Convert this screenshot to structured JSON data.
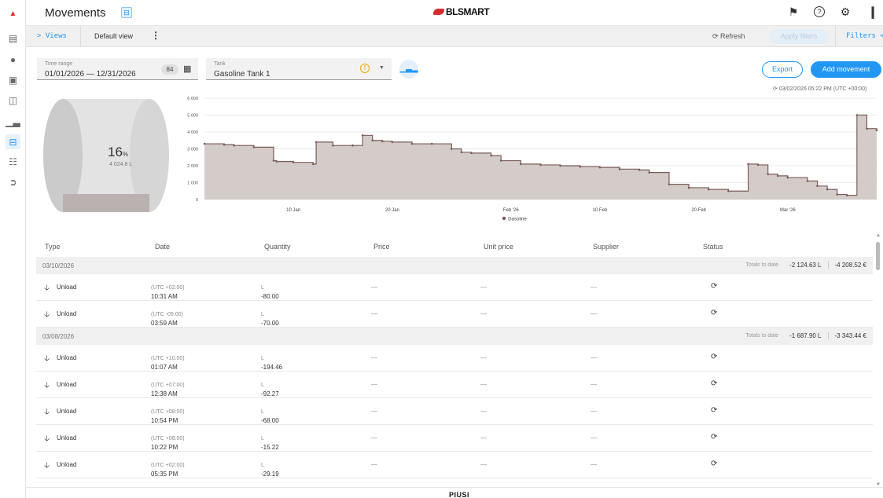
{
  "header": {
    "title": "Movements",
    "brand": "BLSMART",
    "icons": [
      "bell-icon",
      "help-icon",
      "settings-icon",
      "account-icon"
    ]
  },
  "sidebar": {
    "items": [
      "logo-icon",
      "monitor-icon",
      "user-icon",
      "vehicle-icon",
      "fuel-station-icon",
      "bar-chart-icon",
      "movements-icon",
      "map-icon",
      "export-icon"
    ]
  },
  "toolbar": {
    "views_label": "> Views",
    "default_view_label": "Default view",
    "refresh_label": "Refresh",
    "apply_filters_label": "Apply filters",
    "filters_label": "Filters <"
  },
  "filters": {
    "time_range_label": "Time range",
    "time_range_value": "01/01/2026 — 12/31/2026",
    "days_badge": "84",
    "tank_label": "Tank",
    "tank_value": "Gasoline Tank 1"
  },
  "actions": {
    "export_label": "Export",
    "add_label": "Add movement",
    "sync_timestamp": "03/02/2026 05:22 PM (UTC +00:00)"
  },
  "tank": {
    "percent": "16",
    "percent_unit": "%",
    "fill_fraction": 0.16,
    "volume": "4 024.8 L"
  },
  "chart_data": {
    "type": "area",
    "step": true,
    "y_ticks": [
      "0",
      "1 000",
      "2 000",
      "3 000",
      "4 000",
      "5 000",
      "6 000"
    ],
    "ylim": [
      0,
      6000
    ],
    "x_tick_labels": [
      "10 Jan",
      "20 Jan",
      "Feb '26",
      "10 Feb",
      "20 Feb",
      "Mar '26"
    ],
    "x_tick_days": [
      9,
      19,
      31,
      40,
      50,
      59
    ],
    "xlim": [
      0,
      68
    ],
    "legend": "Gasoline",
    "color": "#7a5c58",
    "fill": "#cfc6c3",
    "series": [
      {
        "name": "Gasoline",
        "x": [
          0,
          2,
          3,
          5,
          7,
          7.3,
          9,
          11,
          11.3,
          13,
          15,
          16,
          17,
          18,
          19,
          21,
          23,
          25,
          26,
          27,
          29,
          30,
          32,
          34,
          36,
          38,
          40,
          42,
          44,
          45,
          47,
          49,
          51,
          53,
          55,
          56,
          57,
          58,
          59,
          61,
          62,
          63,
          64,
          65,
          66,
          67,
          68
        ],
        "y": [
          3300,
          3250,
          3200,
          3100,
          2300,
          2250,
          2200,
          2100,
          3400,
          3200,
          3200,
          3800,
          3500,
          3450,
          3400,
          3300,
          3300,
          3000,
          2800,
          2750,
          2600,
          2300,
          2100,
          2050,
          2000,
          1950,
          1900,
          1800,
          1750,
          1600,
          900,
          700,
          600,
          500,
          2100,
          2050,
          1500,
          1400,
          1300,
          1100,
          800,
          600,
          300,
          250,
          5000,
          4200,
          4100
        ]
      }
    ]
  },
  "table": {
    "columns": [
      "Type",
      "Date",
      "Quantity",
      "Price",
      "Unit price",
      "Supplier",
      "Status"
    ],
    "totals_label": "Totals to date",
    "groups": [
      {
        "date": "03/10/2026",
        "total_qty": "-2 124.63 L",
        "total_price": "-4 208.52 €",
        "rows": [
          {
            "type": "Unload",
            "time": "10:31 AM",
            "tz": "(UTC +02:00)",
            "qty": "-80.00",
            "unit": "L",
            "price": "—",
            "unit_price": "—",
            "supplier": "—"
          },
          {
            "type": "Unload",
            "time": "03:59 AM",
            "tz": "(UTC -09:00)",
            "qty": "-70.00",
            "unit": "L",
            "price": "—",
            "unit_price": "—",
            "supplier": "—"
          }
        ]
      },
      {
        "date": "03/08/2026",
        "total_qty": "-1 687.90 L",
        "total_price": "-3 343.44 €",
        "rows": [
          {
            "type": "Unload",
            "time": "01:07 AM",
            "tz": "(UTC +10:00)",
            "qty": "-194.46",
            "unit": "L",
            "price": "—",
            "unit_price": "—",
            "supplier": "—"
          },
          {
            "type": "Unload",
            "time": "12:38 AM",
            "tz": "(UTC +07:00)",
            "qty": "-92.27",
            "unit": "L",
            "price": "—",
            "unit_price": "—",
            "supplier": "—"
          },
          {
            "type": "Unload",
            "time": "10:54 PM",
            "tz": "(UTC +08:00)",
            "qty": "-68.00",
            "unit": "L",
            "price": "—",
            "unit_price": "—",
            "supplier": "—"
          },
          {
            "type": "Unload",
            "time": "10:22 PM",
            "tz": "(UTC +08:00)",
            "qty": "-15.22",
            "unit": "L",
            "price": "—",
            "unit_price": "—",
            "supplier": "—"
          },
          {
            "type": "Unload",
            "time": "05:35 PM",
            "tz": "(UTC +02:00)",
            "qty": "-29.19",
            "unit": "L",
            "price": "—",
            "unit_price": "—",
            "supplier": "—"
          }
        ]
      }
    ]
  },
  "footer": {
    "brand": "PIUSI"
  },
  "colors": {
    "accent": "#2196f3",
    "warning": "#f0a800",
    "series": "#7a5c58"
  }
}
